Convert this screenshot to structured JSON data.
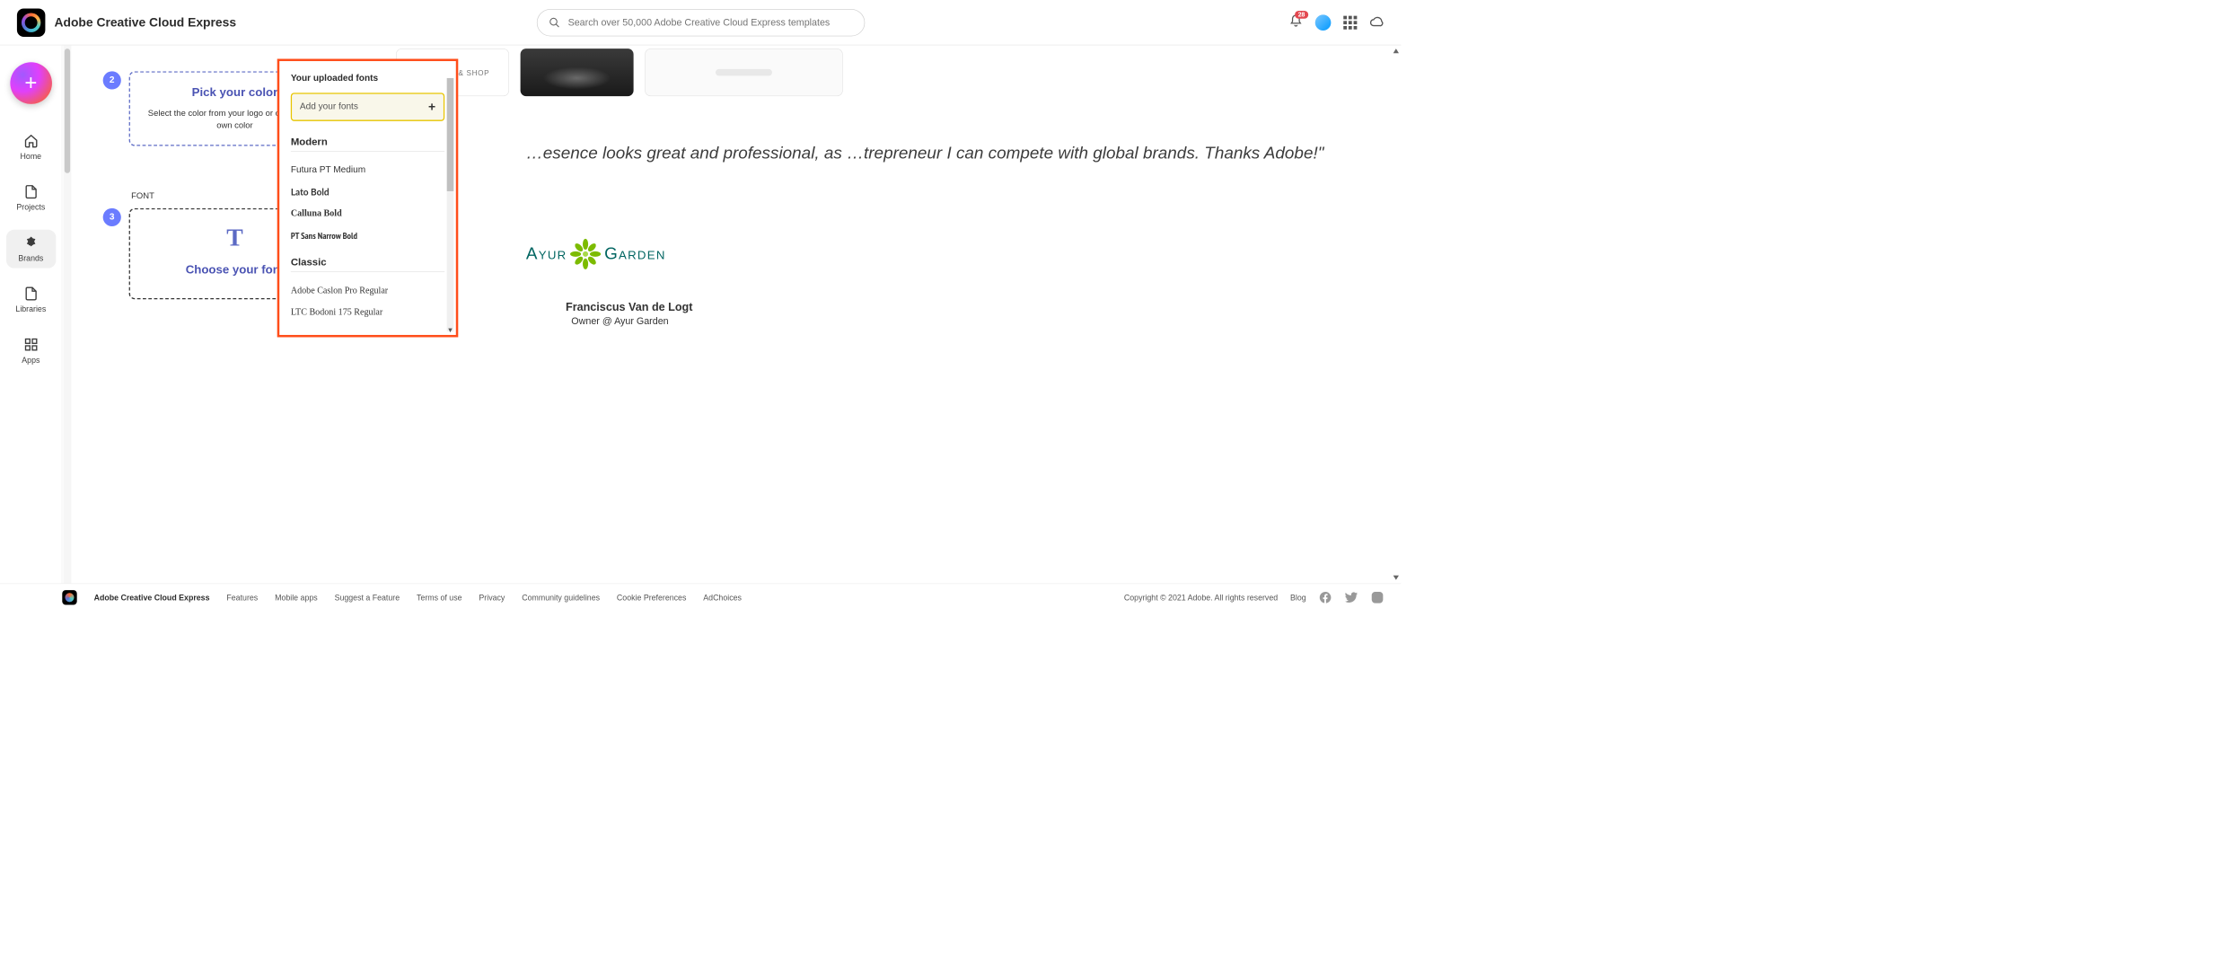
{
  "header": {
    "app_title": "Adobe Creative Cloud Express",
    "search_placeholder": "Search over 50,000 Adobe Creative Cloud Express templates",
    "notification_count": "28"
  },
  "rail": {
    "items": [
      {
        "id": "home",
        "label": "Home"
      },
      {
        "id": "projects",
        "label": "Projects"
      },
      {
        "id": "brands",
        "label": "Brands",
        "active": true
      },
      {
        "id": "libraries",
        "label": "Libraries"
      },
      {
        "id": "apps",
        "label": "Apps"
      }
    ]
  },
  "steps": {
    "step2": {
      "num": "2",
      "title": "Pick your color",
      "desc": "Select the color from your logo or choose your own color"
    },
    "font_label": "FONT",
    "step3": {
      "num": "3",
      "glyph": "T",
      "title": "Choose your font"
    }
  },
  "templates": {
    "swipe": "SWIPE UP & SHOP"
  },
  "fontPopover": {
    "uploaded_heading": "Your uploaded fonts",
    "add_label": "Add your fonts",
    "sections": [
      {
        "title": "Modern",
        "fonts": [
          "Futura PT Medium",
          "Lato Bold",
          "Calluna Bold",
          "PT Sans Narrow Bold"
        ]
      },
      {
        "title": "Classic",
        "fonts": [
          "Adobe Caslon Pro Regular",
          "LTC Bodoni 175 Regular"
        ]
      }
    ]
  },
  "testimonial": {
    "quote": "…esence looks great and professional, as …trepreneur I can compete with global brands. Thanks Adobe!\"",
    "brand_left": "Ayur",
    "brand_right": "Garden",
    "name": "Franciscus Van de Logt",
    "title": "Owner @ Ayur Garden"
  },
  "footer": {
    "name": "Adobe Creative Cloud Express",
    "links": [
      "Features",
      "Mobile apps",
      "Suggest a Feature",
      "Terms of use",
      "Privacy",
      "Community guidelines",
      "Cookie Preferences",
      "AdChoices"
    ],
    "copyright": "Copyright © 2021 Adobe. All rights reserved",
    "blog": "Blog"
  }
}
